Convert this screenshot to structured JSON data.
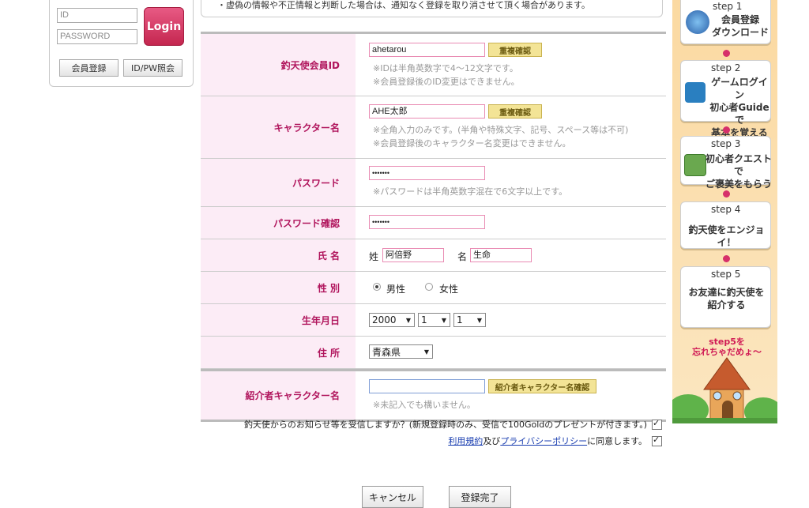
{
  "login": {
    "id_placeholder": "ID",
    "password_placeholder": "PASSWORD",
    "login_label": "Login",
    "register_label": "会員登録",
    "lookup_label": "ID/PW照会"
  },
  "notice": "・虚偽の情報や不正情報と判断した場合は、通知なく登録を取り消させて頂く場合があります。",
  "form": {
    "member_id": {
      "label": "釣天使会員ID",
      "value": "ahetarou",
      "check_label": "重複確認",
      "note1": "※IDは半角英数字で4～12文字です。",
      "note2": "※会員登録後のID変更はできません。"
    },
    "character": {
      "label": "キャラクター名",
      "value": "AHE太郎",
      "check_label": "重複確認",
      "note1": "※全角入力のみです。(半角や特殊文字、記号、スペース等は不可)",
      "note2": "※会員登録後のキャラクター名変更はできません。"
    },
    "password": {
      "label": "パスワード",
      "value": "•••••••",
      "note": "※パスワードは半角英数字混在で6文字以上です。"
    },
    "password_confirm": {
      "label": "パスワード確認",
      "value": "•••••••"
    },
    "name": {
      "label": "氏 名",
      "last_label": "姓",
      "last_value": "阿倍野",
      "first_label": "名",
      "first_value": "生命"
    },
    "gender": {
      "label": "性 別",
      "male": "男性",
      "female": "女性",
      "selected": "male"
    },
    "birthday": {
      "label": "生年月日",
      "year": "2000",
      "month": "1",
      "day": "1"
    },
    "address": {
      "label": "住 所",
      "value": "青森県"
    },
    "referrer": {
      "label": "紹介者キャラクター名",
      "value": "",
      "check_label": "紹介者キャラクター名確認",
      "note": "※未記入でも構いません。"
    }
  },
  "agreements": {
    "newsletter": "釣天使からのお知らせ等を受信しますか？(新規登録時のみ、受信で100Goldのプレゼントが付きます。)",
    "terms_link": "利用規約",
    "and": "及び",
    "privacy_link": "プライバシーポリシー",
    "agree_suffix": "に同意します。"
  },
  "buttons": {
    "cancel": "キャンセル",
    "submit": "登録完了"
  },
  "sidebar": {
    "steps": [
      {
        "no": "step 1",
        "text": "会員登録\nダウンロード"
      },
      {
        "no": "step 2",
        "text": "ゲームログイン\n初心者Guideで\n基本を覚える"
      },
      {
        "no": "step 3",
        "text": "初心者クエストで\nご褒美をもらう"
      },
      {
        "no": "step 4",
        "text": "釣天使をエンジョイ！"
      },
      {
        "no": "step 5",
        "text": "お友達に釣天使を\n紹介する"
      }
    ],
    "reminder": "step5を\n忘れちゃだめょ～"
  },
  "colors": {
    "label_bg": "#fcecf6",
    "label_text": "#b0145c",
    "login_button": "#d63a63",
    "sidebar_bg": "#fbd9a1",
    "accent_dot": "#d6306a"
  }
}
